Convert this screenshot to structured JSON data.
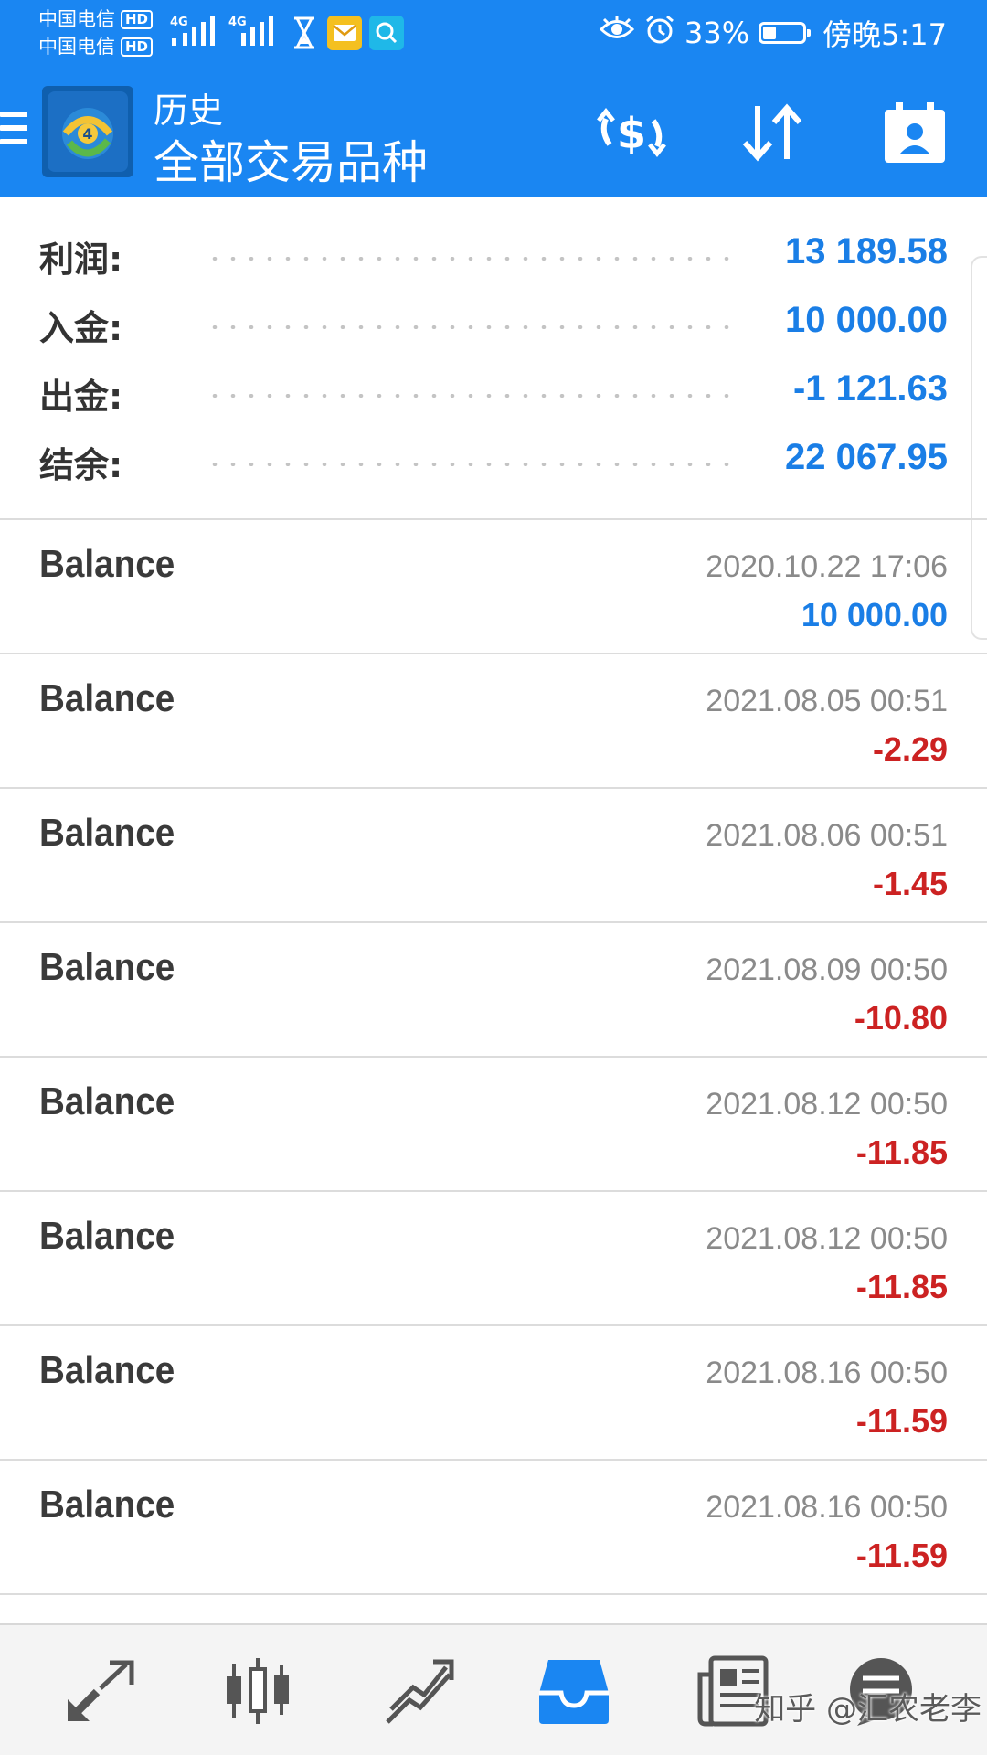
{
  "status_bar": {
    "carrier_1": "中国电信",
    "carrier_2": "中国电信",
    "hd_badge": "HD",
    "network_1": "4G",
    "network_2": "4G",
    "battery_percent_text": "33%",
    "battery_level": 0.33,
    "time": "傍晚5:17"
  },
  "app_bar": {
    "subtitle": "历史",
    "title": "全部交易品种",
    "icons": [
      "menu-icon",
      "metatrader-logo",
      "currency-exchange-icon",
      "sort-icon",
      "calendar-contact-icon"
    ]
  },
  "summary": {
    "rows": [
      {
        "label": "利润:",
        "value": "13 189.58"
      },
      {
        "label": "入金:",
        "value": "10 000.00"
      },
      {
        "label": "出金:",
        "value": "-1 121.63"
      },
      {
        "label": "结余:",
        "value": "22 067.95"
      }
    ]
  },
  "history": [
    {
      "title": "Balance",
      "time": "2020.10.22 17:06",
      "amount": "10 000.00",
      "sign": "positive"
    },
    {
      "title": "Balance",
      "time": "2021.08.05 00:51",
      "amount": "-2.29",
      "sign": "negative"
    },
    {
      "title": "Balance",
      "time": "2021.08.06 00:51",
      "amount": "-1.45",
      "sign": "negative"
    },
    {
      "title": "Balance",
      "time": "2021.08.09 00:50",
      "amount": "-10.80",
      "sign": "negative"
    },
    {
      "title": "Balance",
      "time": "2021.08.12 00:50",
      "amount": "-11.85",
      "sign": "negative"
    },
    {
      "title": "Balance",
      "time": "2021.08.12 00:50",
      "amount": "-11.85",
      "sign": "negative"
    },
    {
      "title": "Balance",
      "time": "2021.08.16 00:50",
      "amount": "-11.59",
      "sign": "negative"
    },
    {
      "title": "Balance",
      "time": "2021.08.16 00:50",
      "amount": "-11.59",
      "sign": "negative"
    }
  ],
  "bottom_nav": {
    "items": [
      "quotes-icon",
      "chart-icon",
      "trade-icon",
      "history-icon",
      "news-icon",
      "chat-icon"
    ],
    "active_color": "#1a86f2",
    "inactive_color": "#555555"
  },
  "watermark": "知乎 @汇农老李",
  "colors": {
    "brand_blue": "#1a86f2",
    "positive": "#1a7ee6",
    "negative": "#cc2222"
  }
}
